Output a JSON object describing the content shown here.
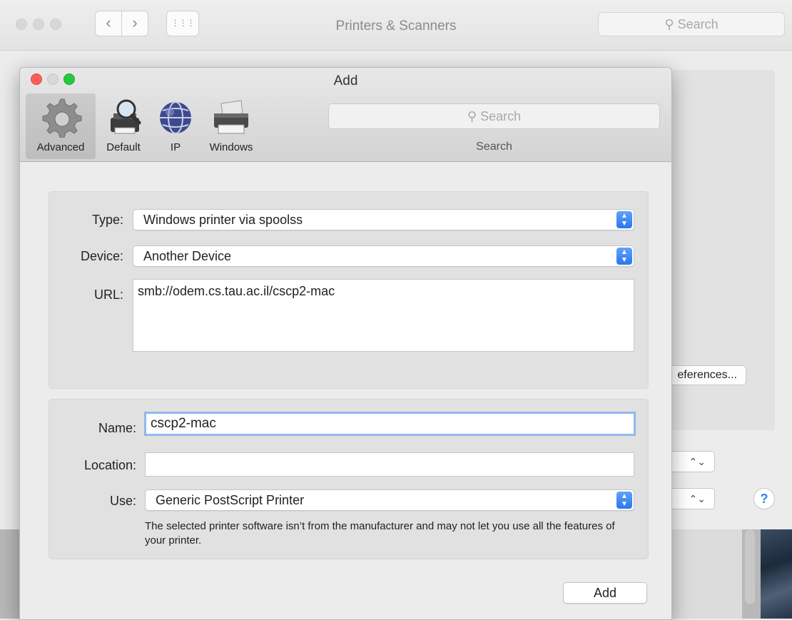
{
  "background_window": {
    "title": "Printers & Scanners",
    "search_placeholder": "Search",
    "back_glyph": "‹",
    "forward_glyph": "›",
    "grid_glyph": "⋮⋮⋮",
    "prefs_button_label": "eferences...",
    "stepper_glyph": "⌃⌄",
    "help_glyph": "?"
  },
  "sheet": {
    "title": "Add",
    "toolbar": {
      "tools": [
        {
          "label": "Advanced",
          "icon": "gear-icon",
          "active": true
        },
        {
          "label": "Default",
          "icon": "printer-search-icon",
          "active": false
        },
        {
          "label": "IP",
          "icon": "globe-icon",
          "active": false
        },
        {
          "label": "Windows",
          "icon": "printer-icon",
          "active": false
        }
      ],
      "search_placeholder": "Search",
      "search_label": "Search"
    },
    "connection": {
      "type_label": "Type:",
      "type_value": "Windows printer via spoolss",
      "device_label": "Device:",
      "device_value": "Another Device",
      "url_label": "URL:",
      "url_value": "smb://odem.cs.tau.ac.il/cscp2-mac"
    },
    "details": {
      "name_label": "Name:",
      "name_value": "cscp2-mac",
      "location_label": "Location:",
      "location_value": "",
      "use_label": "Use:",
      "use_value": "Generic PostScript Printer",
      "note": "The selected printer software isn’t from the manufacturer and may not let you use all the features of your printer."
    },
    "add_button": "Add"
  },
  "colors": {
    "accent": "#2f7cf6",
    "close": "#fc5f57",
    "maximize": "#27c93f",
    "focus_ring": "#8fb9ec"
  }
}
